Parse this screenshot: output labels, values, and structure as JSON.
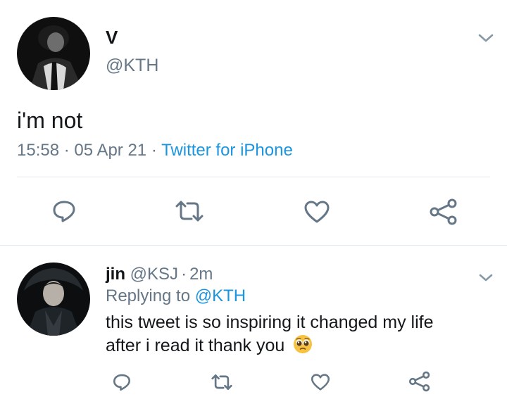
{
  "tweet": {
    "display_name": "V",
    "handle": "@KTH",
    "text": "i'm not",
    "time": "15:58",
    "sep1": "·",
    "date": "05 Apr 21",
    "sep2": "·",
    "source": "Twitter for iPhone"
  },
  "reply": {
    "display_name": "jin",
    "handle": "@KSJ",
    "sep": "·",
    "age": "2m",
    "replying_prefix": "Replying to",
    "replying_handle": "@KTH",
    "text_line1": "this tweet is so inspiring it changed my life",
    "text_line2": "after i read it thank you",
    "emoji": "pleading-face-emoji"
  },
  "actions": [
    "reply-icon",
    "retweet-icon",
    "like-icon",
    "share-icon"
  ],
  "colors": {
    "icon": "#657786",
    "link": "#1b95e0",
    "divider": "#e1e8ed",
    "text": "#14171a"
  }
}
